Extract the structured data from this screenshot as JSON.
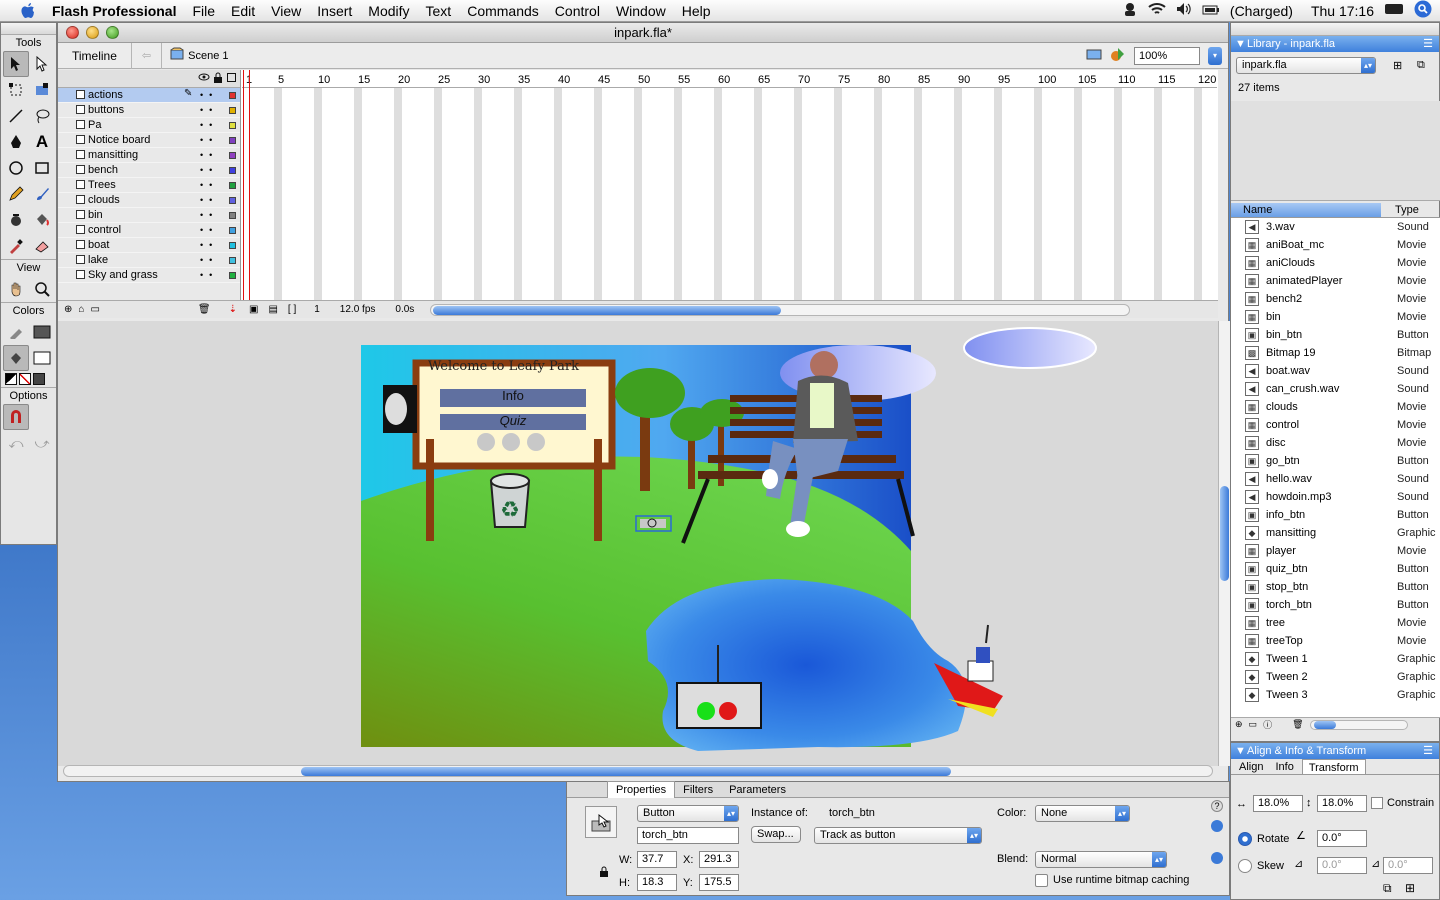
{
  "menubar": {
    "app_name": "Flash Professional",
    "items": [
      "File",
      "Edit",
      "View",
      "Insert",
      "Modify",
      "Text",
      "Commands",
      "Control",
      "Window",
      "Help"
    ],
    "battery_status": "(Charged)",
    "clock": "Thu 17:16"
  },
  "tools_panel": {
    "title": "Tools",
    "view_label": "View",
    "colors_label": "Colors",
    "options_label": "Options"
  },
  "document": {
    "title": "inpark.fla*",
    "timeline_tab": "Timeline",
    "scene": "Scene 1",
    "zoom": "100%",
    "layers": [
      "actions",
      "buttons",
      "Pa",
      "Notice board",
      "mansitting",
      "bench",
      "Trees",
      "clouds",
      "bin",
      "control",
      "boat",
      "lake",
      "Sky and grass"
    ],
    "layer_colors": [
      "#e03030",
      "#e0b000",
      "#e0e040",
      "#8040c0",
      "#9040c0",
      "#4040e0",
      "#20a040",
      "#6060e0",
      "#808080",
      "#40a0e0",
      "#20c0e0",
      "#40c0e0",
      "#20b040"
    ],
    "frame_numbers": [
      "1",
      "5",
      "10",
      "15",
      "20",
      "25",
      "30",
      "35",
      "40",
      "45",
      "50",
      "55",
      "60",
      "65",
      "70",
      "75",
      "80",
      "85",
      "90",
      "95",
      "100",
      "105",
      "110",
      "115",
      "120"
    ],
    "footer": {
      "current_frame": "1",
      "fps": "12.0 fps",
      "time": "0.0s"
    }
  },
  "stage": {
    "notice_title": "Welcome to Leafy Park",
    "info_button": "Info",
    "quiz_button": "Quiz"
  },
  "properties": {
    "tabs": [
      "Properties",
      "Filters",
      "Parameters"
    ],
    "symbol_type": "Button",
    "instance_of_label": "Instance of:",
    "instance_of": "torch_btn",
    "instance_name": "torch_btn",
    "swap_label": "Swap...",
    "tracking": "Track as button",
    "color_label": "Color:",
    "color_value": "None",
    "blend_label": "Blend:",
    "blend_value": "Normal",
    "bitmap_caching_label": "Use runtime bitmap caching",
    "w_label": "W:",
    "w": "37.7",
    "x_label": "X:",
    "x": "291.3",
    "h_label": "H:",
    "h": "18.3",
    "y_label": "Y:",
    "y": "175.5"
  },
  "library": {
    "title": "Library - inpark.fla",
    "file_select": "inpark.fla",
    "item_count": "27 items",
    "col_name": "Name",
    "col_type": "Type",
    "items": [
      {
        "name": "3.wav",
        "type": "Sound",
        "icon": "sound"
      },
      {
        "name": "aniBoat_mc",
        "type": "Movie",
        "icon": "movie"
      },
      {
        "name": "aniClouds",
        "type": "Movie",
        "icon": "movie"
      },
      {
        "name": "animatedPlayer",
        "type": "Movie",
        "icon": "movie"
      },
      {
        "name": "bench2",
        "type": "Movie",
        "icon": "movie"
      },
      {
        "name": "bin",
        "type": "Movie",
        "icon": "movie"
      },
      {
        "name": "bin_btn",
        "type": "Button",
        "icon": "button"
      },
      {
        "name": "Bitmap 19",
        "type": "Bitmap",
        "icon": "bitmap"
      },
      {
        "name": "boat.wav",
        "type": "Sound",
        "icon": "sound"
      },
      {
        "name": "can_crush.wav",
        "type": "Sound",
        "icon": "sound"
      },
      {
        "name": "clouds",
        "type": "Movie",
        "icon": "movie"
      },
      {
        "name": "control",
        "type": "Movie",
        "icon": "movie"
      },
      {
        "name": "disc",
        "type": "Movie",
        "icon": "movie"
      },
      {
        "name": "go_btn",
        "type": "Button",
        "icon": "button"
      },
      {
        "name": "hello.wav",
        "type": "Sound",
        "icon": "sound"
      },
      {
        "name": "howdoin.mp3",
        "type": "Sound",
        "icon": "sound"
      },
      {
        "name": "info_btn",
        "type": "Button",
        "icon": "button"
      },
      {
        "name": "mansitting",
        "type": "Graphic",
        "icon": "graphic"
      },
      {
        "name": "player",
        "type": "Movie",
        "icon": "movie"
      },
      {
        "name": "quiz_btn",
        "type": "Button",
        "icon": "button"
      },
      {
        "name": "stop_btn",
        "type": "Button",
        "icon": "button"
      },
      {
        "name": "torch_btn",
        "type": "Button",
        "icon": "button"
      },
      {
        "name": "tree",
        "type": "Movie",
        "icon": "movie"
      },
      {
        "name": "treeTop",
        "type": "Movie",
        "icon": "movie"
      },
      {
        "name": "Tween 1",
        "type": "Graphic",
        "icon": "graphic"
      },
      {
        "name": "Tween 2",
        "type": "Graphic",
        "icon": "graphic"
      },
      {
        "name": "Tween 3",
        "type": "Graphic",
        "icon": "graphic"
      }
    ]
  },
  "align_panel": {
    "title": "Align & Info & Transform",
    "tabs": [
      "Align",
      "Info",
      "Transform"
    ],
    "scale_w": "18.0%",
    "scale_h": "18.0%",
    "constrain_label": "Constrain",
    "rotate_label": "Rotate",
    "rotate_value": "0.0°",
    "skew_label": "Skew",
    "skew_h": "0.0°",
    "skew_v": "0.0°"
  }
}
